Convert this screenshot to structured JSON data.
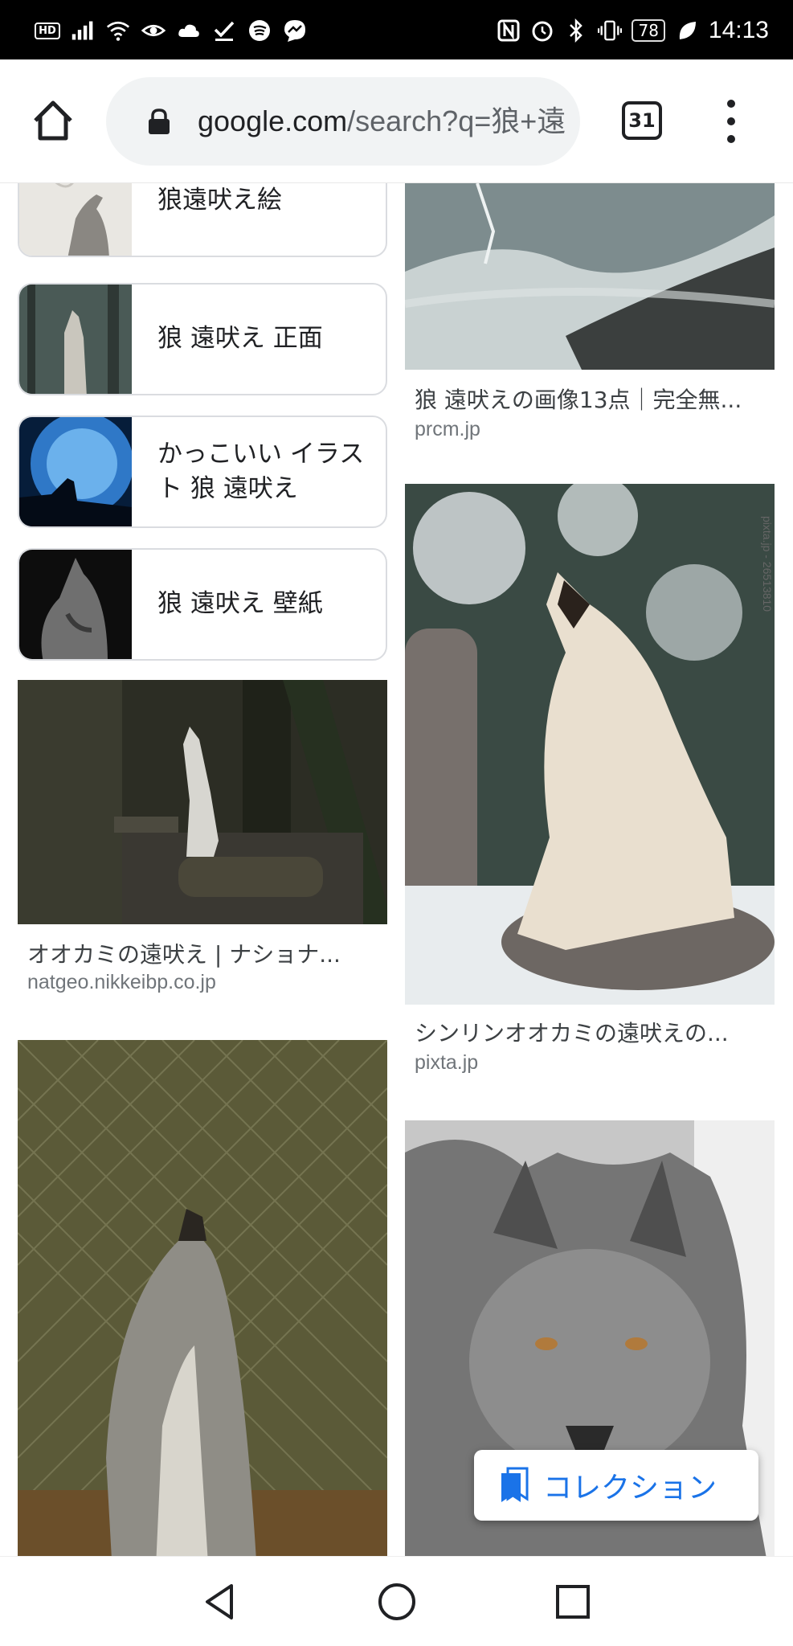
{
  "status_bar": {
    "left_icons": [
      "hd-icon",
      "signal-icon",
      "wifi-icon",
      "eye-icon",
      "cloud-icon",
      "check-icon",
      "spotify-icon",
      "messenger-icon"
    ],
    "hd_label": "HD",
    "right_icons": [
      "nfc-icon",
      "alarm-icon",
      "bluetooth-icon",
      "vibrate-icon"
    ],
    "battery": "78",
    "time": "14:13"
  },
  "browser": {
    "url_domain": "google.com",
    "url_rest": "/search?q=狼+遠",
    "tab_count": "31"
  },
  "related_searches": [
    {
      "label": "狼遠吠え絵",
      "thumb": "wolf-sketch"
    },
    {
      "label": "狼 遠吠え 正面",
      "thumb": "wolf-forest"
    },
    {
      "label": "かっこいい イラスト 狼 遠吠え",
      "thumb": "wolf-moon"
    },
    {
      "label": "狼 遠吠え 壁紙",
      "thumb": "wolf-dark"
    }
  ],
  "results_left": [
    {
      "title": "オオカミの遠吠え | ナショナ...",
      "source": "natgeo.nikkeibp.co.jp"
    },
    {
      "title": "",
      "source": ""
    }
  ],
  "results_right": [
    {
      "title": "狼 遠吠えの画像13点｜完全無...",
      "source": "prcm.jp"
    },
    {
      "title": "シンリンオオカミの遠吠えの...",
      "source": "pixta.jp",
      "watermark": "pixta.jp - 26513810"
    },
    {
      "title": "",
      "source": ""
    }
  ],
  "collection_button": {
    "label": "コレクション"
  },
  "nav": {
    "icons": [
      "back-icon",
      "home-circle-icon",
      "recents-icon"
    ]
  }
}
